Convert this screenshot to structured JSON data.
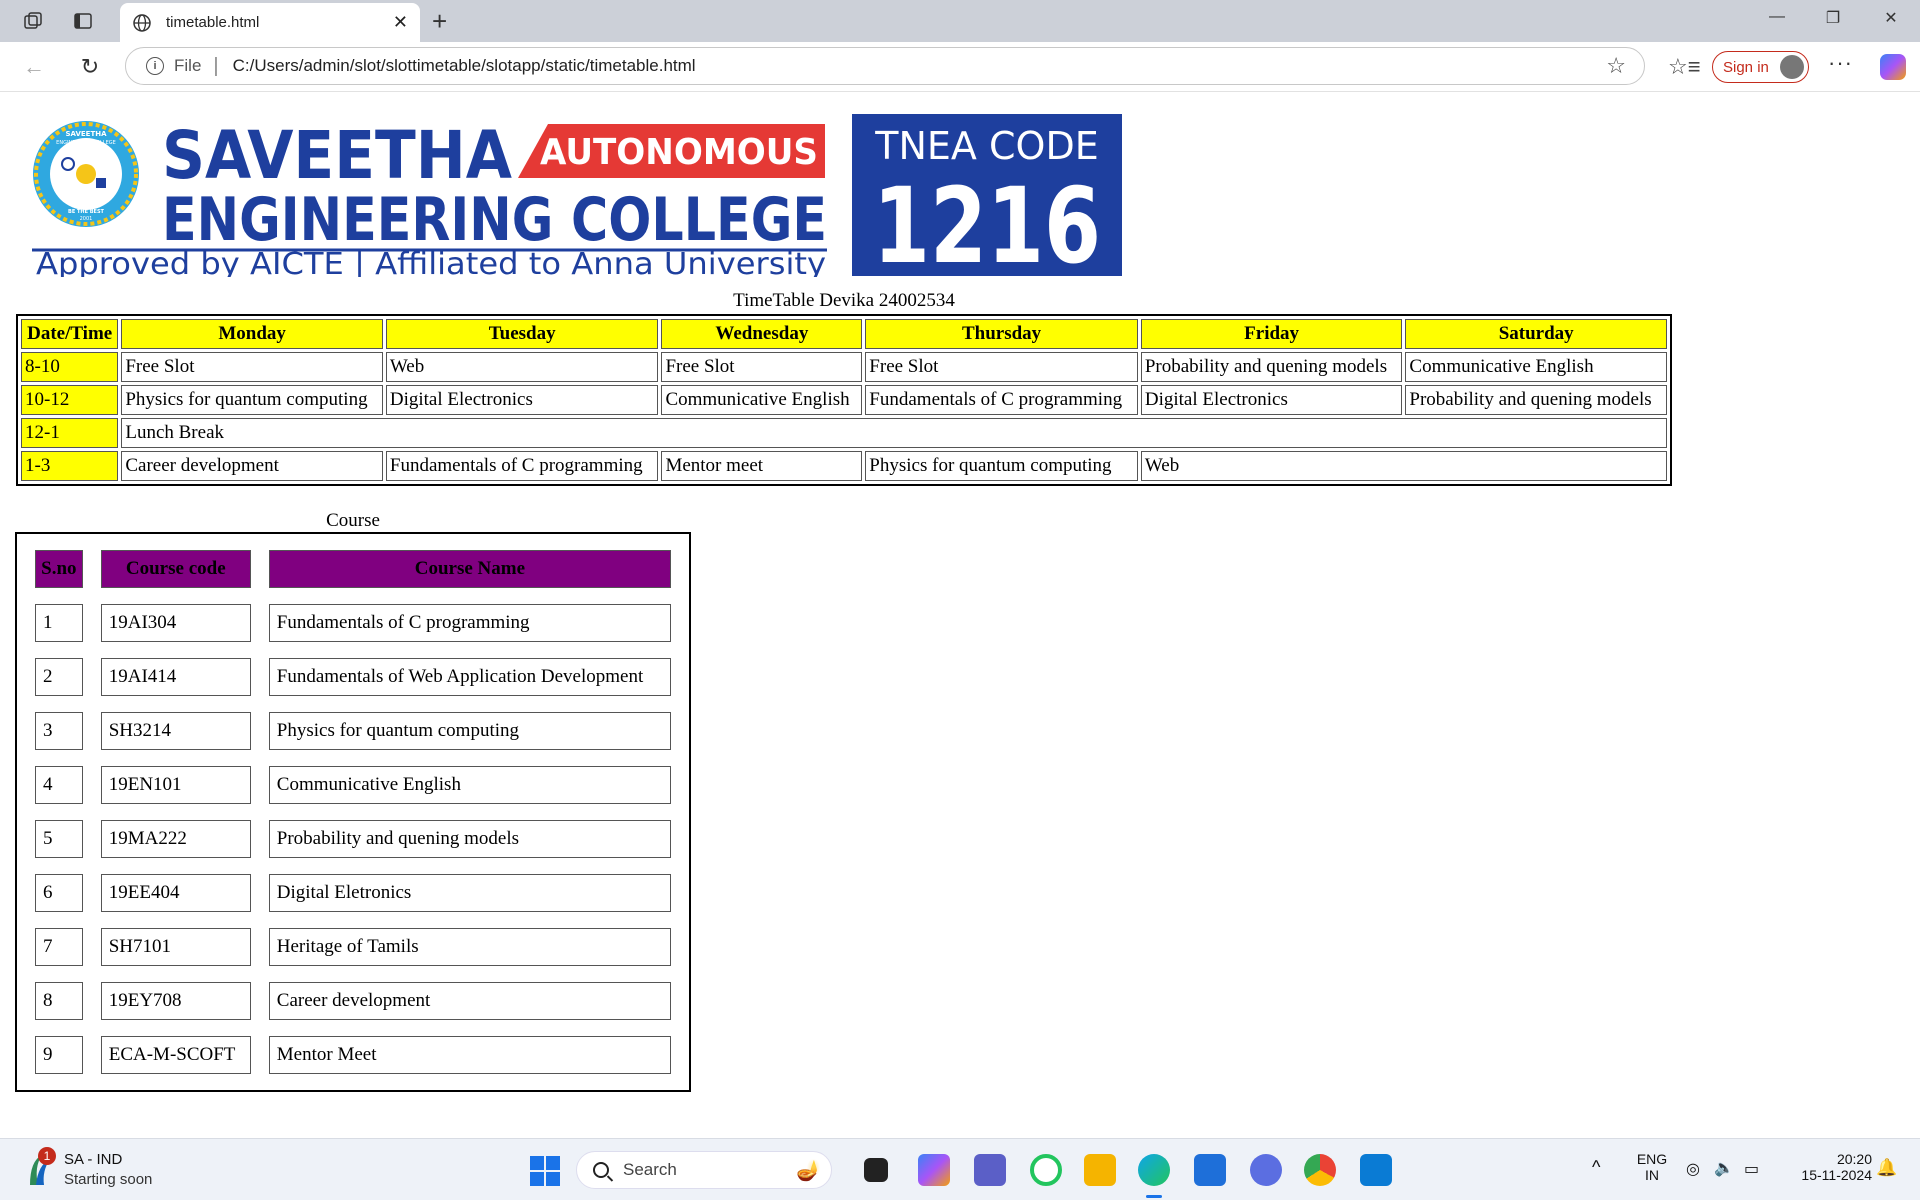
{
  "browser": {
    "tab_title": "timetable.html",
    "address_scheme": "File",
    "address_url": "C:/Users/admin/slot/slottimetable/slotapp/static/timetable.html",
    "signin_label": "Sign in"
  },
  "logo": {
    "college_line1": "SAVEETHA",
    "autonomous": "AUTONOMOUS",
    "college_line2": "ENGINEERING COLLEGE",
    "approved": "Approved by AICTE  |  Affiliated to Anna University",
    "tnea_label": "TNEA CODE",
    "tnea_code": "1216",
    "seal_top": "SAVEETHA",
    "seal_sub": "ENGINEERING COLLEGE",
    "seal_motto": "BE THE BEST",
    "seal_year": "2001"
  },
  "timetable": {
    "caption": "TimeTable Devika 24002534",
    "headers": [
      "Date/Time",
      "Monday",
      "Tuesday",
      "Wednesday",
      "Thursday",
      "Friday",
      "Saturday"
    ],
    "rows": [
      {
        "time": "8-10",
        "cells": [
          "Free Slot",
          "Web",
          "Free Slot",
          "Free Slot",
          "Probability and quening models",
          "Communicative English"
        ]
      },
      {
        "time": "10-12",
        "cells": [
          "Physics for quantum computing",
          "Digital Electronics",
          "Communicative English",
          "Fundamentals of C programming",
          "Digital Electronics",
          "Probability and quening models"
        ]
      },
      {
        "time": "12-1",
        "lunch": "Lunch Break"
      },
      {
        "time": "1-3",
        "cells": [
          "Career development",
          "Fundamentals of C programming",
          "Mentor meet",
          "Physics for quantum computing",
          "Web"
        ]
      }
    ]
  },
  "courses": {
    "caption": "Course",
    "headers": [
      "S.no",
      "Course code",
      "Course Name"
    ],
    "rows": [
      [
        "1",
        "19AI304",
        "Fundamentals of C programming"
      ],
      [
        "2",
        "19AI414",
        "Fundamentals of Web Application Development"
      ],
      [
        "3",
        "SH3214",
        "Physics for quantum computing"
      ],
      [
        "4",
        "19EN101",
        "Communicative English"
      ],
      [
        "5",
        "19MA222",
        "Probability and quening models"
      ],
      [
        "6",
        "19EE404",
        "Digital Eletronics"
      ],
      [
        "7",
        "SH7101",
        "Heritage of Tamils"
      ],
      [
        "8",
        "19EY708",
        "Career development"
      ],
      [
        "9",
        "ECA-M-SCOFT",
        "Mentor Meet"
      ]
    ]
  },
  "taskbar": {
    "weather_badge": "1",
    "weather_title": "SA - IND",
    "weather_sub": "Starting soon",
    "search_label": "Search",
    "lang_line1": "ENG",
    "lang_line2": "IN",
    "time": "20:20",
    "date": "15-11-2024"
  },
  "colors": {
    "header_yellow": "#ffff00",
    "course_header_purple": "#800080",
    "logo_blue": "#1e3f9e",
    "logo_red": "#e53935"
  }
}
